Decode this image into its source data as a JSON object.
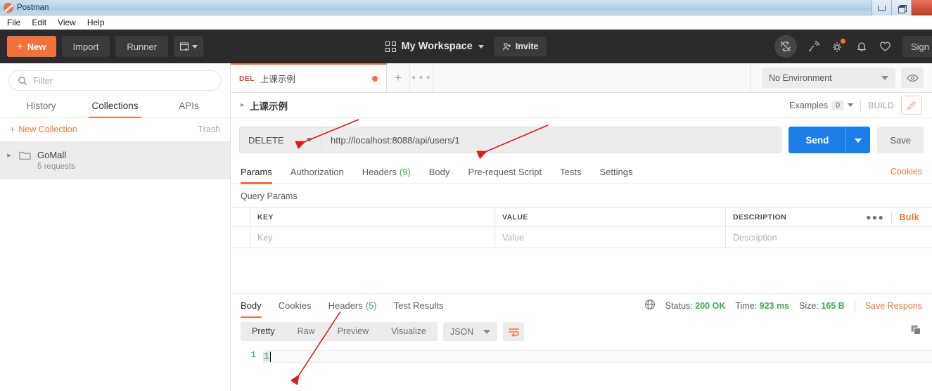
{
  "window": {
    "title": "Postman",
    "controls": {
      "minimize": "minimize-button",
      "restore": "restore-button",
      "close": "close-button"
    }
  },
  "menubar": {
    "items": [
      "File",
      "Edit",
      "View",
      "Help"
    ]
  },
  "topbar": {
    "new_label": "New",
    "import_label": "Import",
    "runner_label": "Runner",
    "workspace_label": "My Workspace",
    "invite_label": "Invite",
    "signin_label": "Sign",
    "icons": [
      "sync-off-icon",
      "broadcast-icon",
      "gear-icon",
      "bell-icon",
      "heart-icon"
    ]
  },
  "sidebar": {
    "filter_placeholder": "Filter",
    "tabs": [
      {
        "label": "History",
        "active": false
      },
      {
        "label": "Collections",
        "active": true
      },
      {
        "label": "APIs",
        "active": false
      }
    ],
    "new_collection_label": "New Collection",
    "trash_label": "Trash",
    "collections": [
      {
        "name": "GoMall",
        "sub": "5 requests"
      }
    ]
  },
  "tabstrip": {
    "request_tab": {
      "method": "DEL",
      "name": "上课示例",
      "unsaved": true
    },
    "add_label": "+",
    "more_label": "●●●",
    "environment": {
      "value": "No Environment"
    }
  },
  "breadcrumb": {
    "name": "上课示例",
    "examples_label": "Examples",
    "examples_count": "0",
    "build_label": "BUILD"
  },
  "request": {
    "method": "DELETE",
    "url": "http://localhost:8088/api/users/1",
    "send_label": "Send",
    "save_label": "Save",
    "tabs": [
      {
        "label": "Params",
        "count": "",
        "active": true
      },
      {
        "label": "Authorization",
        "count": "",
        "active": false
      },
      {
        "label": "Headers",
        "count": "(9)",
        "active": false
      },
      {
        "label": "Body",
        "count": "",
        "active": false
      },
      {
        "label": "Pre-request Script",
        "count": "",
        "active": false
      },
      {
        "label": "Tests",
        "count": "",
        "active": false
      },
      {
        "label": "Settings",
        "count": "",
        "active": false
      }
    ],
    "cookies_link": "Cookies"
  },
  "query_params": {
    "section_label": "Query Params",
    "columns": [
      "KEY",
      "VALUE",
      "DESCRIPTION"
    ],
    "rows": [
      {
        "key": "Key",
        "value": "Value",
        "description": "Description"
      }
    ],
    "bulk_label": "Bulk"
  },
  "response": {
    "tabs": [
      {
        "label": "Body",
        "count": "",
        "active": true
      },
      {
        "label": "Cookies",
        "count": "",
        "active": false
      },
      {
        "label": "Headers",
        "count": "(5)",
        "active": false
      },
      {
        "label": "Test Results",
        "count": "",
        "active": false
      }
    ],
    "status_label": "Status:",
    "status_value": "200 OK",
    "time_label": "Time:",
    "time_value": "923 ms",
    "size_label": "Size:",
    "size_value": "165 B",
    "save_response_label": "Save Respons",
    "view_modes": [
      {
        "label": "Pretty",
        "active": true
      },
      {
        "label": "Raw",
        "active": false
      },
      {
        "label": "Preview",
        "active": false
      },
      {
        "label": "Visualize",
        "active": false
      }
    ],
    "format": "JSON",
    "body_lines": [
      {
        "number": "1",
        "text": "1"
      }
    ]
  },
  "colors": {
    "accent_orange": "#f3713b",
    "send_blue": "#1a7fe8",
    "status_green": "#3fa95b",
    "delete_red": "#e1493e",
    "topbar_dark": "#2b2b2b",
    "annotation_red": "#e01b1b"
  }
}
